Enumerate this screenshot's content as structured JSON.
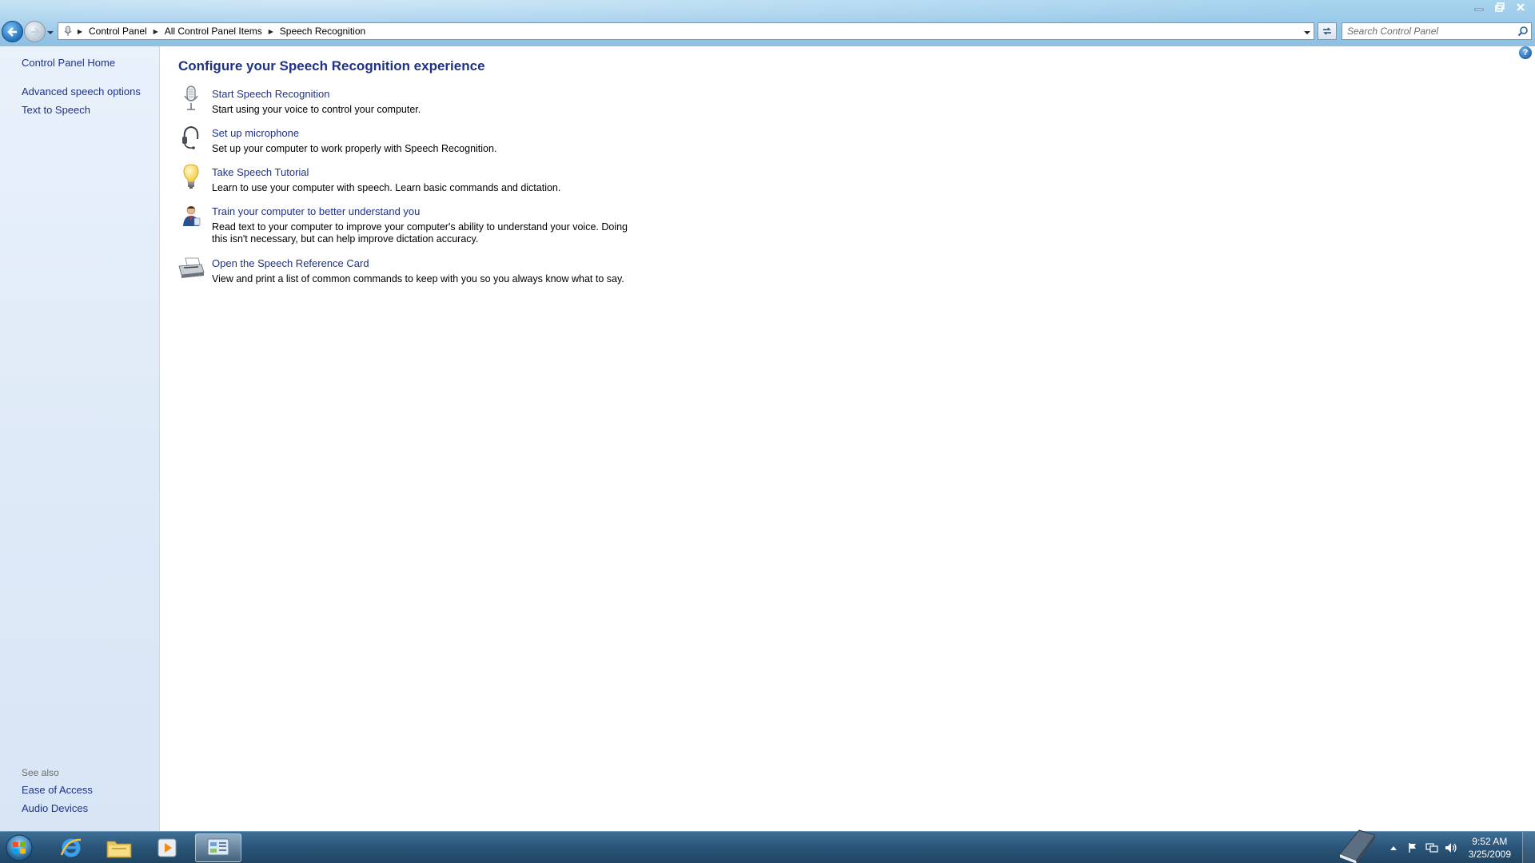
{
  "window": {
    "controls": {
      "minimize": "minimize",
      "maximize": "maximize",
      "close": "close"
    }
  },
  "address": {
    "breadcrumbs": [
      "Control Panel",
      "All Control Panel Items",
      "Speech Recognition"
    ]
  },
  "search": {
    "placeholder": "Search Control Panel"
  },
  "left_pane": {
    "home_link": "Control Panel Home",
    "links": [
      "Advanced speech options",
      "Text to Speech"
    ],
    "see_also_header": "See also",
    "see_also": [
      "Ease of Access",
      "Audio Devices"
    ]
  },
  "main": {
    "title": "Configure your Speech Recognition experience",
    "tasks": [
      {
        "icon": "microphone-icon",
        "label": "Start Speech Recognition",
        "desc": "Start using your voice to control your computer."
      },
      {
        "icon": "headset-icon",
        "label": "Set up microphone",
        "desc": "Set up your computer to work properly with Speech Recognition."
      },
      {
        "icon": "lightbulb-icon",
        "label": "Take Speech Tutorial",
        "desc": "Learn to use your computer with speech.  Learn basic commands and dictation."
      },
      {
        "icon": "person-train-icon",
        "label": "Train your computer to better understand you",
        "desc": "Read text to your computer to improve your computer's ability to understand your voice.  Doing this isn't necessary, but can help improve dictation accuracy."
      },
      {
        "icon": "printer-icon",
        "label": "Open the Speech Reference Card",
        "desc": "View and print a list of common commands to keep with you so you always know what to say."
      }
    ]
  },
  "taskbar": {
    "apps": [
      "internet-explorer-icon",
      "windows-explorer-icon",
      "media-player-icon",
      "control-panel-icon"
    ],
    "clock": {
      "time": "9:52 AM",
      "date": "3/25/2009"
    }
  },
  "colors": {
    "link": "#1e3287",
    "title": "#1e3287",
    "left_pane_bg": "#e3edf9",
    "taskbar": "#2a5478"
  }
}
